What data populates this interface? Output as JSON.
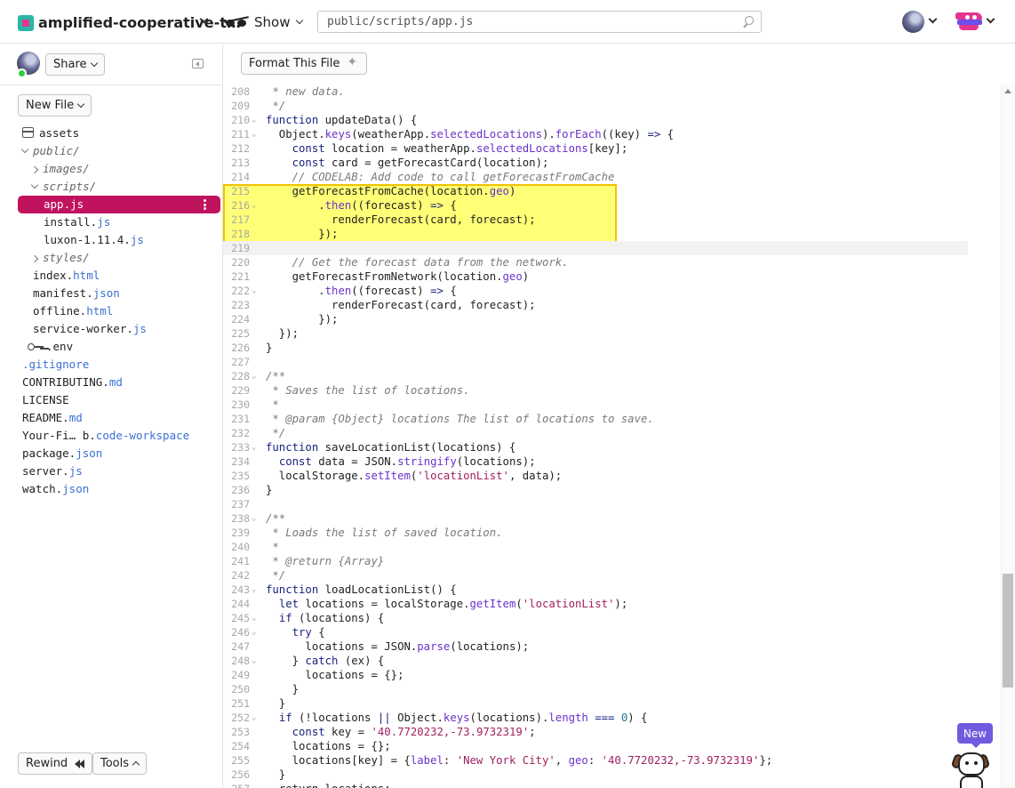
{
  "topbar": {
    "project_name": "amplified-cooperative-t…",
    "show_label": "Show",
    "file_path": "public/scripts/app.js"
  },
  "sidebar": {
    "share_label": "Share",
    "new_file_label": "New File",
    "tree": [
      {
        "name": "assets",
        "ext": "",
        "type": "assets"
      },
      {
        "name": "public/",
        "ext": "",
        "type": "folder-open"
      },
      {
        "name": "images/",
        "ext": "",
        "type": "folder-closed"
      },
      {
        "name": "scripts/",
        "ext": "",
        "type": "folder-open"
      },
      {
        "name": "app.",
        "ext": "js",
        "type": "file-selected"
      },
      {
        "name": "install.",
        "ext": "js",
        "type": "file"
      },
      {
        "name": "luxon-1.11.4.",
        "ext": "js",
        "type": "file"
      },
      {
        "name": "styles/",
        "ext": "",
        "type": "folder-closed"
      },
      {
        "name": "index.",
        "ext": "html",
        "type": "file"
      },
      {
        "name": "manifest.",
        "ext": "json",
        "type": "file"
      },
      {
        "name": "offline.",
        "ext": "html",
        "type": "file"
      },
      {
        "name": "service-worker.",
        "ext": "js",
        "type": "file"
      },
      {
        "name": ".env",
        "ext": "",
        "type": "env"
      },
      {
        "name": "",
        "ext": ".gitignore",
        "type": "file"
      },
      {
        "name": "CONTRIBUTING.",
        "ext": "md",
        "type": "file"
      },
      {
        "name": "LICENSE",
        "ext": "",
        "type": "file"
      },
      {
        "name": "README.",
        "ext": "md",
        "type": "file"
      },
      {
        "name": "Your-Fi… b.",
        "ext": "code-workspace",
        "type": "file"
      },
      {
        "name": "package.",
        "ext": "json",
        "type": "file"
      },
      {
        "name": "server.",
        "ext": "js",
        "type": "file"
      },
      {
        "name": "watch.",
        "ext": "json",
        "type": "file"
      }
    ],
    "rewind_label": "Rewind",
    "tools_label": "Tools"
  },
  "editor": {
    "format_label": "Format This File",
    "highlight_color": "#ffff77",
    "lines": [
      {
        "n": "208",
        "fold": false,
        "html": "<span class=\"cm\"> * new data.</span>"
      },
      {
        "n": "209",
        "fold": false,
        "html": "<span class=\"cm\"> */</span>"
      },
      {
        "n": "210",
        "fold": true,
        "html": "<span class=\"kw\">function</span> updateData() {"
      },
      {
        "n": "211",
        "fold": true,
        "html": "  Object.<span class=\"pr\">keys</span>(weatherApp.<span class=\"pr\">selectedLocations</span>).<span class=\"pr\">forEach</span>((key) <span class=\"kw\">=&gt;</span> {"
      },
      {
        "n": "212",
        "fold": false,
        "html": "    <span class=\"kw\">const</span> location = weatherApp.<span class=\"pr\">selectedLocations</span>[key];"
      },
      {
        "n": "213",
        "fold": false,
        "html": "    <span class=\"kw\">const</span> card = getForecastCard(location);"
      },
      {
        "n": "214",
        "fold": false,
        "html": "    <span class=\"cm\">// CODELAB: Add code to call getForecastFromCache</span>"
      },
      {
        "n": "215",
        "fold": false,
        "html": "    getForecastFromCache(location.<span class=\"pr\">geo</span>)"
      },
      {
        "n": "216",
        "fold": true,
        "html": "        .<span class=\"pr\">then</span>((forecast) <span class=\"kw\">=&gt;</span> {"
      },
      {
        "n": "217",
        "fold": false,
        "html": "          renderForecast(card, forecast);"
      },
      {
        "n": "218",
        "fold": false,
        "html": "        });"
      },
      {
        "n": "219",
        "fold": false,
        "html": ""
      },
      {
        "n": "220",
        "fold": false,
        "html": "    <span class=\"cm\">// Get the forecast data from the network.</span>"
      },
      {
        "n": "221",
        "fold": false,
        "html": "    getForecastFromNetwork(location.<span class=\"pr\">geo</span>)"
      },
      {
        "n": "222",
        "fold": true,
        "html": "        .<span class=\"pr\">then</span>((forecast) <span class=\"kw\">=&gt;</span> {"
      },
      {
        "n": "223",
        "fold": false,
        "html": "          renderForecast(card, forecast);"
      },
      {
        "n": "224",
        "fold": false,
        "html": "        });"
      },
      {
        "n": "225",
        "fold": false,
        "html": "  });"
      },
      {
        "n": "226",
        "fold": false,
        "html": "}"
      },
      {
        "n": "227",
        "fold": false,
        "html": ""
      },
      {
        "n": "228",
        "fold": true,
        "html": "<span class=\"cm\">/**</span>"
      },
      {
        "n": "229",
        "fold": false,
        "html": "<span class=\"cm\"> * Saves the list of locations.</span>"
      },
      {
        "n": "230",
        "fold": false,
        "html": "<span class=\"cm\"> *</span>"
      },
      {
        "n": "231",
        "fold": false,
        "html": "<span class=\"cm\"> * @param {Object} locations The list of locations to save.</span>"
      },
      {
        "n": "232",
        "fold": false,
        "html": "<span class=\"cm\"> */</span>"
      },
      {
        "n": "233",
        "fold": true,
        "html": "<span class=\"kw\">function</span> saveLocationList(locations) {"
      },
      {
        "n": "234",
        "fold": false,
        "html": "  <span class=\"kw\">const</span> data = JSON.<span class=\"pr\">stringify</span>(locations);"
      },
      {
        "n": "235",
        "fold": false,
        "html": "  localStorage.<span class=\"pr\">setItem</span>(<span class=\"st\">'locationList'</span>, data);"
      },
      {
        "n": "236",
        "fold": false,
        "html": "}"
      },
      {
        "n": "237",
        "fold": false,
        "html": ""
      },
      {
        "n": "238",
        "fold": true,
        "html": "<span class=\"cm\">/**</span>"
      },
      {
        "n": "239",
        "fold": false,
        "html": "<span class=\"cm\"> * Loads the list of saved location.</span>"
      },
      {
        "n": "240",
        "fold": false,
        "html": "<span class=\"cm\"> *</span>"
      },
      {
        "n": "241",
        "fold": false,
        "html": "<span class=\"cm\"> * @return {Array}</span>"
      },
      {
        "n": "242",
        "fold": false,
        "html": "<span class=\"cm\"> */</span>"
      },
      {
        "n": "243",
        "fold": true,
        "html": "<span class=\"kw\">function</span> loadLocationList() {"
      },
      {
        "n": "244",
        "fold": false,
        "html": "  <span class=\"kw\">let</span> locations = localStorage.<span class=\"pr\">getItem</span>(<span class=\"st\">'locationList'</span>);"
      },
      {
        "n": "245",
        "fold": true,
        "html": "  <span class=\"kw\">if</span> (locations) {"
      },
      {
        "n": "246",
        "fold": true,
        "html": "    <span class=\"kw\">try</span> {"
      },
      {
        "n": "247",
        "fold": false,
        "html": "      locations = JSON.<span class=\"pr\">parse</span>(locations);"
      },
      {
        "n": "248",
        "fold": true,
        "html": "    } <span class=\"kw\">catch</span> (ex) {"
      },
      {
        "n": "249",
        "fold": false,
        "html": "      locations = {};"
      },
      {
        "n": "250",
        "fold": false,
        "html": "    }"
      },
      {
        "n": "251",
        "fold": false,
        "html": "  }"
      },
      {
        "n": "252",
        "fold": true,
        "html": "  <span class=\"kw\">if</span> (!locations <span class=\"kw\">||</span> Object.<span class=\"pr\">keys</span>(locations).<span class=\"pr\">length</span> <span class=\"kw\">===</span> <span class=\"nm\">0</span>) {"
      },
      {
        "n": "253",
        "fold": false,
        "html": "    <span class=\"kw\">const</span> key = <span class=\"st\">'40.7720232,-73.9732319'</span>;"
      },
      {
        "n": "254",
        "fold": false,
        "html": "    locations = {};"
      },
      {
        "n": "255",
        "fold": false,
        "html": "    locations[key] = {<span class=\"pr\">label</span>: <span class=\"st\">'New York City'</span>, <span class=\"pr\">geo</span>: <span class=\"st\">'40.7720232,-73.9732319'</span>};"
      },
      {
        "n": "256",
        "fold": false,
        "html": "  }"
      },
      {
        "n": "257",
        "fold": false,
        "html": "  return locations;"
      }
    ]
  },
  "badge": {
    "new_label": "New"
  }
}
